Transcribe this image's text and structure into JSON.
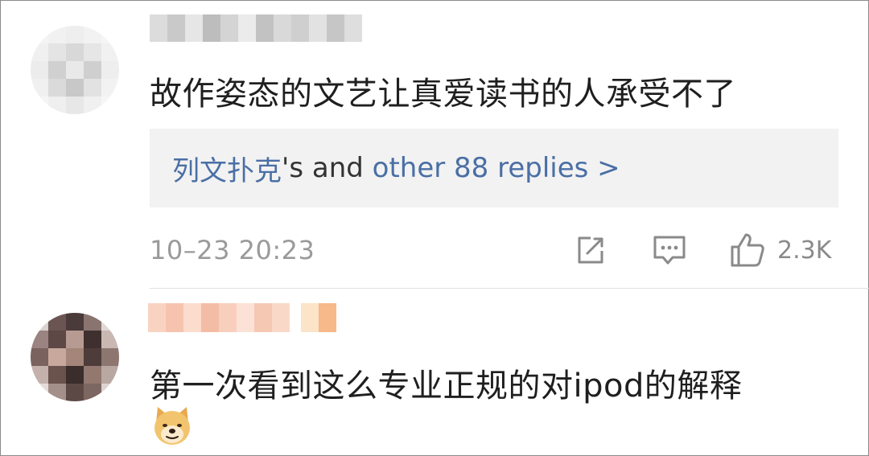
{
  "comments": [
    {
      "text": "故作姿态的文艺让真爱读书的人承受不了",
      "replies": {
        "user": "列文扑克",
        "middle": "'s and ",
        "more": "other 88 replies >"
      },
      "timestamp": "10–23 20:23",
      "like_count": "2.3K",
      "icons": [
        "share-icon",
        "comment-icon",
        "thumbs-up-icon"
      ]
    },
    {
      "text": "第一次看到这么专业正规的对ipod的解释",
      "emoji": "doge-emoji-icon"
    }
  ],
  "colors": {
    "link": "#4a6fa5",
    "text": "#1f1f1f",
    "meta": "#9a9a9a",
    "reply_bg": "#f2f2f2"
  }
}
